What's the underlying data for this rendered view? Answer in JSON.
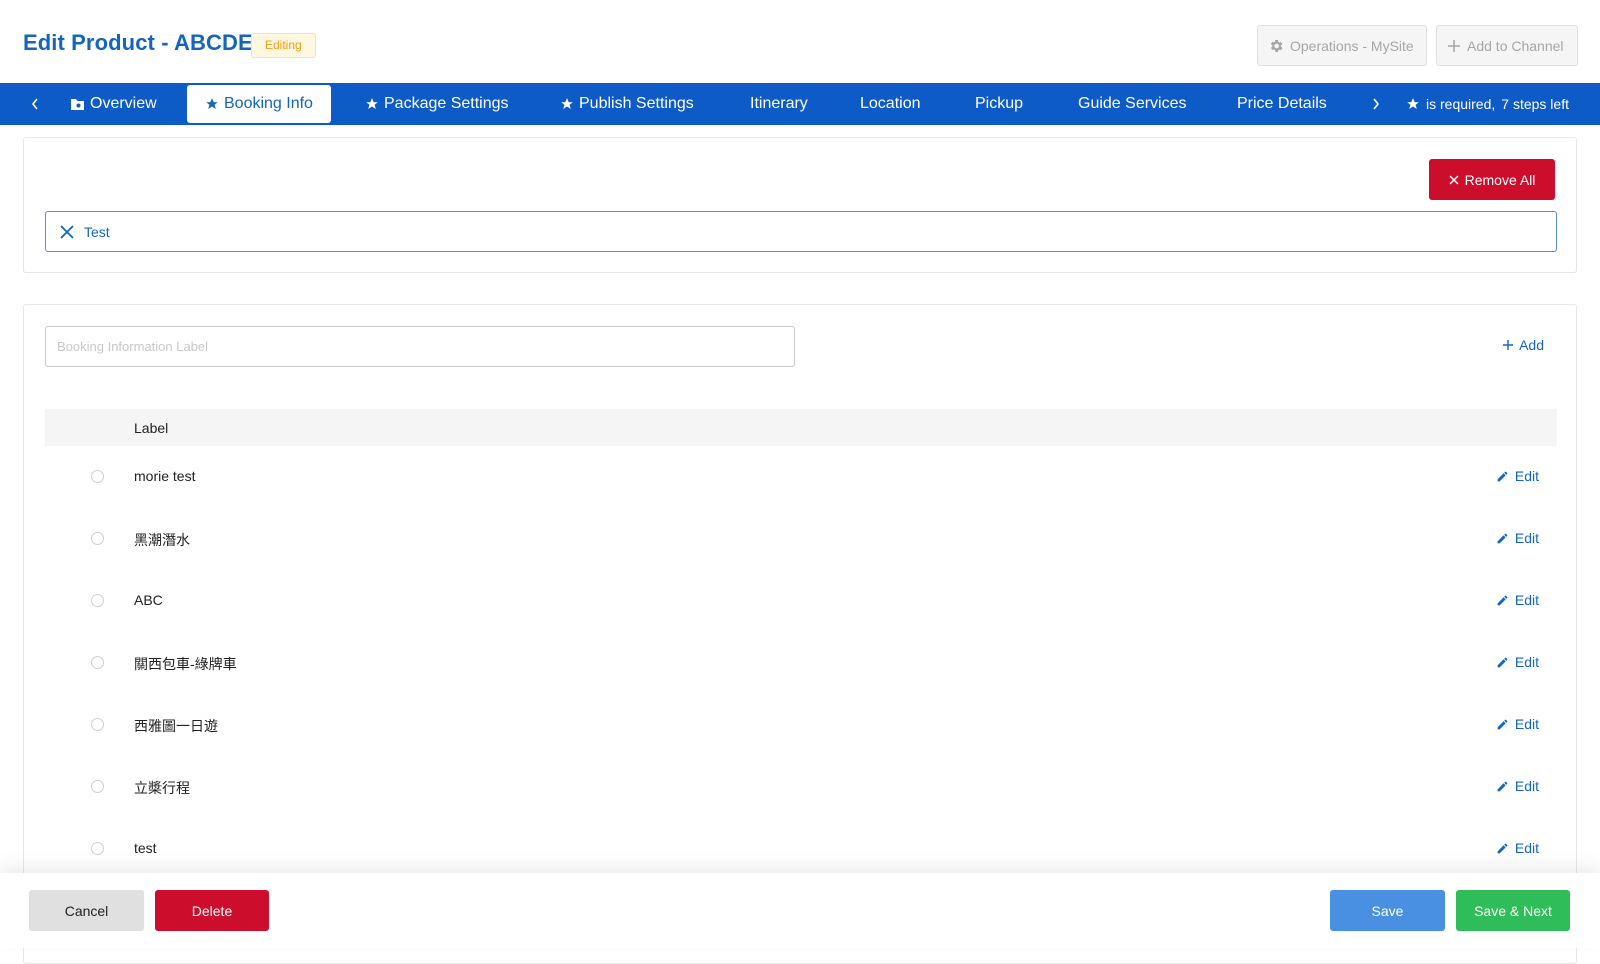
{
  "header": {
    "title": "Edit Product - ABCDE",
    "status_badge": "Editing",
    "operations_button": "Operations - MySite",
    "add_channel_button": "Add to Channel"
  },
  "tabs": [
    {
      "label": "Overview",
      "icon": "folder-icon"
    },
    {
      "label": "Booking Info",
      "icon": "star-icon",
      "active": true
    },
    {
      "label": "Package Settings",
      "icon": "star-icon"
    },
    {
      "label": "Publish Settings",
      "icon": "star-icon"
    },
    {
      "label": "Itinerary"
    },
    {
      "label": "Location"
    },
    {
      "label": "Pickup"
    },
    {
      "label": "Guide Services"
    },
    {
      "label": "Price Details"
    }
  ],
  "required_note": {
    "text": "is required,",
    "steps_left": "7 steps left"
  },
  "selected_panel": {
    "remove_all_label": "Remove All",
    "tags": [
      "Test"
    ]
  },
  "booking_info": {
    "input_placeholder": "Booking Information Label",
    "add_label": "Add",
    "column_header": "Label",
    "edit_label": "Edit",
    "rows": [
      "morie test",
      "黑潮潛水",
      "ABC",
      "關西包車-綠牌車",
      "西雅圖一日遊",
      "立槳行程",
      "test"
    ]
  },
  "footer": {
    "cancel_label": "Cancel",
    "delete_label": "Delete",
    "save_label": "Save",
    "save_next_label": "Save & Next"
  },
  "colors": {
    "primary": "#0d5bc6",
    "title_blue": "#1565c0",
    "danger": "#cc0d2c",
    "save_blue": "#4a90e2",
    "success": "#2ebd59",
    "badge_orange": "#f29c11"
  }
}
